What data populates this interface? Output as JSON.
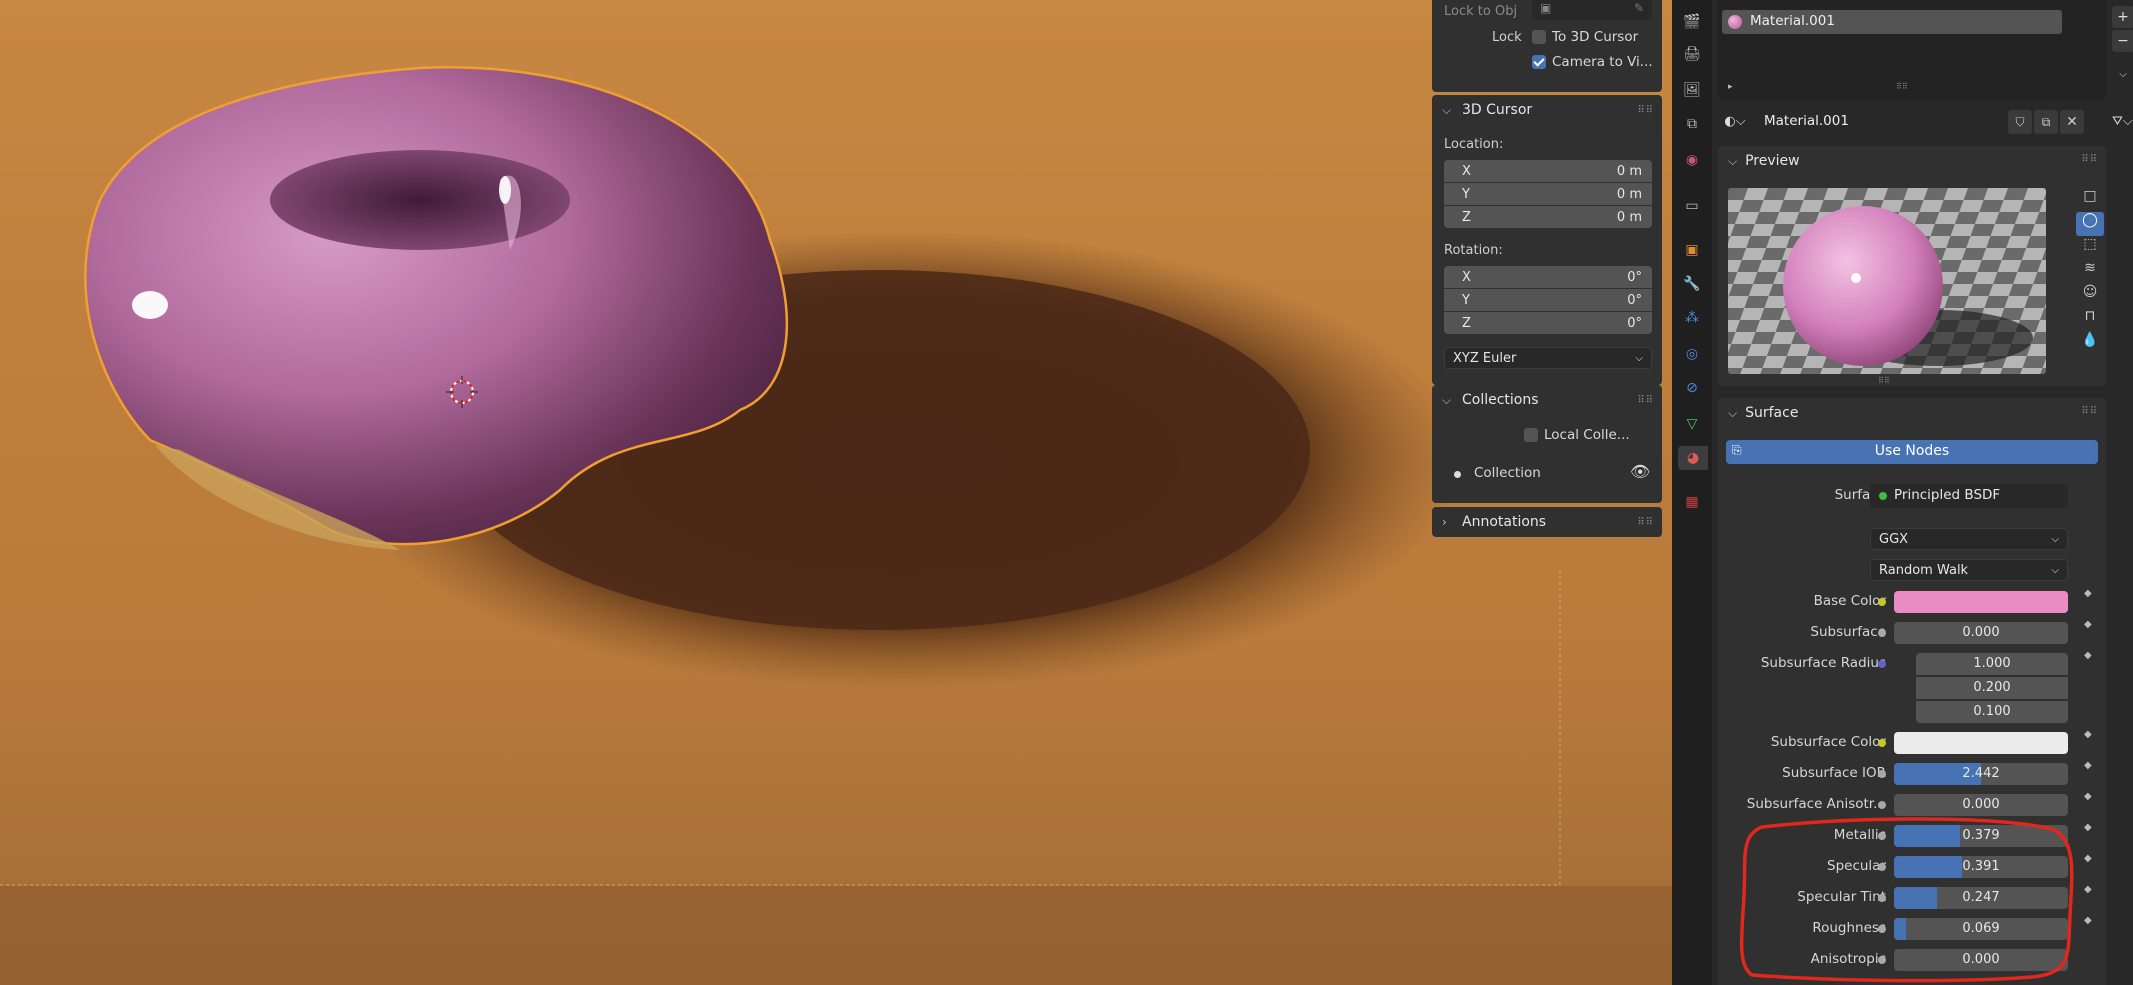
{
  "npanel": {
    "view_lock": {
      "lock_to_obj_label": "Lock to Obj",
      "lock_label": "Lock",
      "to_3d_cursor": "To 3D Cursor",
      "to_3d_cursor_checked": false,
      "camera_to_view": "Camera to Vi...",
      "camera_to_view_checked": true
    },
    "cursor": {
      "title": "3D Cursor",
      "location_label": "Location:",
      "location": [
        {
          "axis": "X",
          "value": "0 m"
        },
        {
          "axis": "Y",
          "value": "0 m"
        },
        {
          "axis": "Z",
          "value": "0 m"
        }
      ],
      "rotation_label": "Rotation:",
      "rotation": [
        {
          "axis": "X",
          "value": "0°"
        },
        {
          "axis": "Y",
          "value": "0°"
        },
        {
          "axis": "Z",
          "value": "0°"
        }
      ],
      "rotation_mode": "XYZ Euler"
    },
    "collections": {
      "title": "Collections",
      "local_collections": "Local Colle...",
      "collection_name": "Collection"
    },
    "annotations": {
      "title": "Annotations"
    }
  },
  "material": {
    "slot_name": "Material.001",
    "datablock_name": "Material.001",
    "preview_title": "Preview",
    "surface_title": "Surface",
    "use_nodes": "Use Nodes",
    "surface_label": "Surface",
    "shader": "Principled BSDF",
    "distribution": "GGX",
    "subsurface_method": "Random Walk",
    "base_color_hex": "#e98cc4",
    "subsurface_color_hex": "#ececec",
    "rows": {
      "base_color": "Base Color",
      "subsurface": {
        "label": "Subsurface",
        "value": "0.000",
        "fraction": 0
      },
      "subsurface_radius": {
        "label": "Subsurface Radius",
        "values": [
          "1.000",
          "0.200",
          "0.100"
        ]
      },
      "subsurface_color": "Subsurface Color",
      "subsurface_ior": {
        "label": "Subsurface IOR",
        "value": "2.442",
        "fraction": 0.5
      },
      "subsurface_aniso": {
        "label": "Subsurface Anisotr...",
        "value": "0.000",
        "fraction": 0
      },
      "metallic": {
        "label": "Metallic",
        "value": "0.379",
        "fraction": 0.379
      },
      "specular": {
        "label": "Specular",
        "value": "0.391",
        "fraction": 0.391
      },
      "specular_tint": {
        "label": "Specular Tint",
        "value": "0.247",
        "fraction": 0.247
      },
      "roughness": {
        "label": "Roughness",
        "value": "0.069",
        "fraction": 0.069
      },
      "anisotropic": {
        "label": "Anisotropic",
        "value": "0.000",
        "fraction": 0
      }
    }
  },
  "colors": {
    "accent": "#4772b3",
    "highlight": "#e0281e",
    "donut": "#c86aa8",
    "selection_outline": "#f0a030"
  }
}
